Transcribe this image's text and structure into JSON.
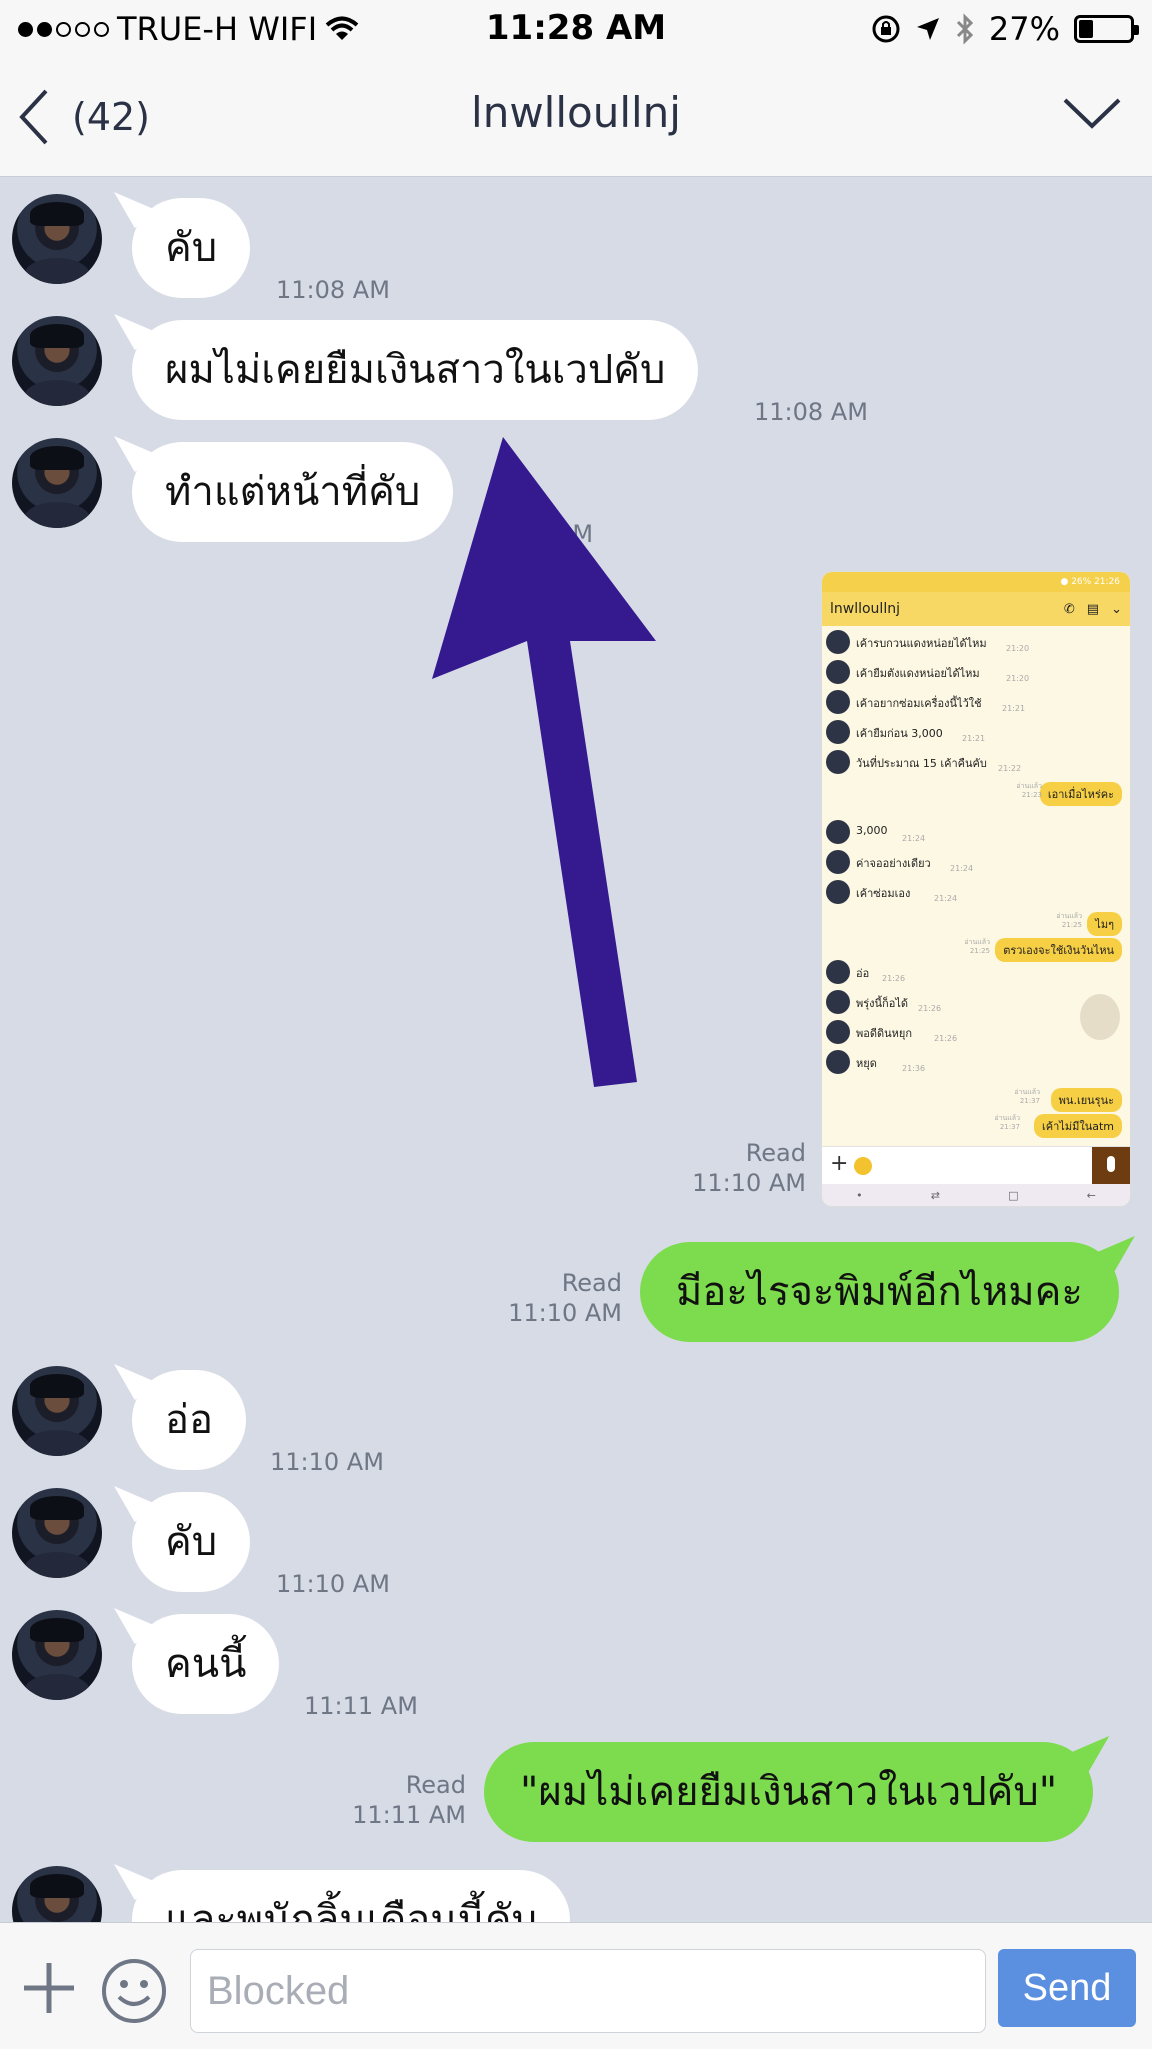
{
  "status_bar": {
    "carrier": "TRUE-H WIFI",
    "time": "11:28 AM",
    "battery": "27%",
    "battery_level": 0.27
  },
  "nav": {
    "back_count": "(42)",
    "title": "lnwlloullnj"
  },
  "messages": {
    "m1": {
      "text": "คับ",
      "time": "11:08 AM"
    },
    "m2": {
      "text": "ผมไม่เคยยืมเงินสาวในเวปคับ",
      "time": "11:08 AM"
    },
    "m3": {
      "text": "ทำแต่หน้าที่คับ",
      "time": "AM"
    },
    "img_meta": {
      "read": "Read",
      "time": "11:10 AM"
    },
    "out1": {
      "text": "มีอะไรจะพิมพ์อีกไหมคะ",
      "read": "Read",
      "time": "11:10 AM"
    },
    "m4": {
      "text": "อ่อ",
      "time": "11:10 AM"
    },
    "m5": {
      "text": "คับ",
      "time": "11:10 AM"
    },
    "m6": {
      "text": "คนนี้",
      "time": "11:11 AM"
    },
    "out2": {
      "text": "\"ผมไม่เคยยืมเงินสาวในเวปคับ\"",
      "read": "Read",
      "time": "11:11 AM"
    },
    "m7": {
      "text": "และพนักลิ้นเดือนนี้คับ"
    }
  },
  "screenshot": {
    "status": "● 26% 21:26",
    "title": "lnwlloullnj",
    "in_rows": [
      {
        "text": "เค้ารบกวนแดงหน่อยได้ไหม",
        "time": "21:20"
      },
      {
        "text": "เค้ายืมตังแดงหน่อยได้ไหม",
        "time": "21:20"
      },
      {
        "text": "เค้าอยากซ่อมเครื่องนี้ไว้ใช้",
        "time": "21:21"
      },
      {
        "text": "เค้ายืมก่อน 3,000",
        "time": "21:21"
      },
      {
        "text": "วันที่ประมาณ 15 เค้าคืนคับ",
        "time": "21:22"
      },
      {
        "text": "3,000",
        "time": "21:24"
      },
      {
        "text": "ค่าจออย่างเดียว",
        "time": "21:24"
      },
      {
        "text": "เค้าซ่อมเอง",
        "time": "21:24"
      },
      {
        "text": "อ่อ",
        "time": "21:26"
      },
      {
        "text": "พรุ่งนี้ก็อได้",
        "time": "21:26"
      },
      {
        "text": "พอดีดินหยุก",
        "time": "21:26"
      },
      {
        "text": "หยุด",
        "time": "21:36"
      }
    ],
    "out_rows": [
      {
        "text": "เอาเมื่อไหร่คะ",
        "read": "อ่านแล้ว",
        "time": "21:23"
      },
      {
        "text": "ไมๆ",
        "read": "อ่านแล้ว",
        "time": "21:25"
      },
      {
        "text": "ตรวเองจะใช้เงินวันไหน",
        "read": "อ่านแล้ว",
        "time": "21:25"
      },
      {
        "text": "พน.เยนรุนะ",
        "read": "อ่านแล้ว",
        "time": "21:37"
      },
      {
        "text": "เค้าไม่มีในatm",
        "read": "อ่านแล้ว",
        "time": "21:37"
      }
    ]
  },
  "input": {
    "placeholder": "Blocked",
    "send_label": "Send"
  },
  "colors": {
    "chat_bg": "#d6dbe5",
    "bubble_out": "#7ddb4e",
    "send_button": "#5b8fe0",
    "arrow": "#35198f"
  },
  "icons": {
    "back": "chevron-left-icon",
    "menu": "chevron-down-icon",
    "attach": "plus-icon",
    "sticker": "smiley-icon",
    "wifi": "wifi-icon",
    "location": "location-arrow-icon",
    "bluetooth": "bluetooth-icon",
    "lock": "rotation-lock-icon"
  }
}
